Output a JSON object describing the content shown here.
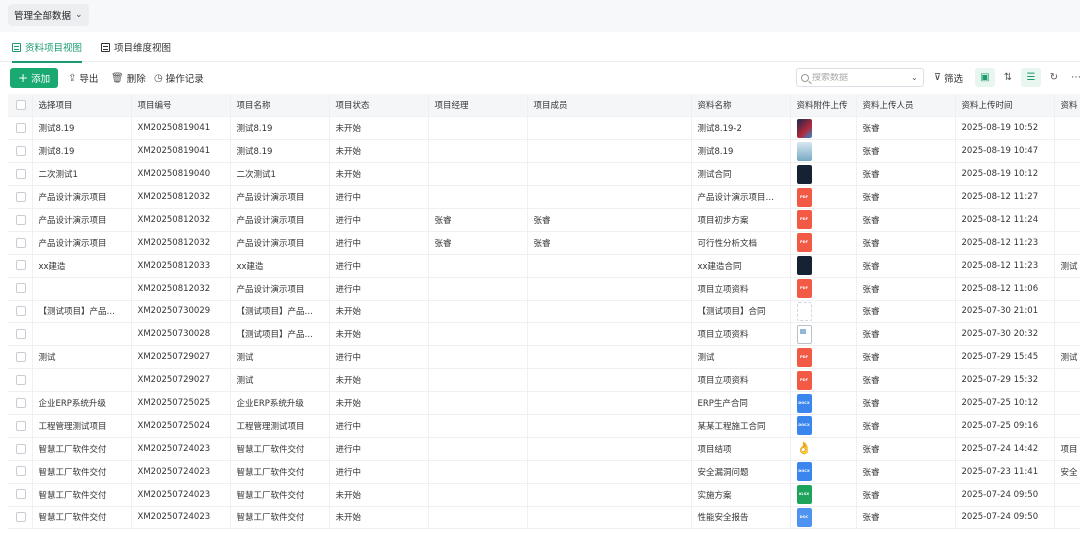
{
  "scope_select": {
    "label": "管理全部数据"
  },
  "view_tabs": [
    {
      "label": "资料项目视图",
      "active": true
    },
    {
      "label": "项目维度视图",
      "active": false
    }
  ],
  "toolbar": {
    "add_label": "添加",
    "export_label": "导出",
    "delete_label": "删除",
    "log_label": "操作记录",
    "search_placeholder": "搜索数据",
    "filter_label": "筛选"
  },
  "colors": {
    "accent": "#1aa971"
  },
  "columns": [
    "选择项目",
    "项目编号",
    "项目名称",
    "项目状态",
    "项目经理",
    "项目成员",
    "资料名称",
    "资料附件上传",
    "资料上传人员",
    "资料上传时间",
    "资料"
  ],
  "rows": [
    {
      "select": "测试8.19",
      "code": "XM20250819041",
      "name": "测试8.19",
      "status": "未开始",
      "manager": "",
      "members": "",
      "doc": "测试8.19-2",
      "file": "img1",
      "uploader": "张睿",
      "time": "2025-08-19 10:52",
      "extra": ""
    },
    {
      "select": "测试8.19",
      "code": "XM20250819041",
      "name": "测试8.19",
      "status": "未开始",
      "manager": "",
      "members": "",
      "doc": "测试8.19",
      "file": "img2",
      "uploader": "张睿",
      "time": "2025-08-19 10:47",
      "extra": ""
    },
    {
      "select": "二次测试1",
      "code": "XM20250819040",
      "name": "二次测试1",
      "status": "未开始",
      "manager": "",
      "members": "",
      "doc": "测试合同",
      "file": "dark",
      "uploader": "张睿",
      "time": "2025-08-19 10:12",
      "extra": ""
    },
    {
      "select": "产品设计演示项目",
      "code": "XM20250812032",
      "name": "产品设计演示项目",
      "status": "进行中",
      "manager": "",
      "members": "",
      "doc": "产品设计演示项目…",
      "file": "pdf",
      "uploader": "张睿",
      "time": "2025-08-12 11:27",
      "extra": ""
    },
    {
      "select": "产品设计演示项目",
      "code": "XM20250812032",
      "name": "产品设计演示项目",
      "status": "进行中",
      "manager": "张睿",
      "members": "张睿",
      "doc": "项目初步方案",
      "file": "pdf",
      "uploader": "张睿",
      "time": "2025-08-12 11:24",
      "extra": ""
    },
    {
      "select": "产品设计演示项目",
      "code": "XM20250812032",
      "name": "产品设计演示项目",
      "status": "进行中",
      "manager": "张睿",
      "members": "张睿",
      "doc": "可行性分析文档",
      "file": "pdf",
      "uploader": "张睿",
      "time": "2025-08-12 11:23",
      "extra": ""
    },
    {
      "select": "xx建造",
      "code": "XM20250812033",
      "name": "xx建造",
      "status": "进行中",
      "manager": "",
      "members": "",
      "doc": "xx建造合同",
      "file": "dark",
      "uploader": "张睿",
      "time": "2025-08-12 11:23",
      "extra": "测试"
    },
    {
      "select": "",
      "code": "XM20250812032",
      "name": "产品设计演示项目",
      "status": "进行中",
      "manager": "",
      "members": "",
      "doc": "项目立项资料",
      "file": "pdf",
      "uploader": "张睿",
      "time": "2025-08-12 11:06",
      "extra": ""
    },
    {
      "select": "【测试项目】产品…",
      "code": "XM20250730029",
      "name": "【测试项目】产品…",
      "status": "未开始",
      "manager": "",
      "members": "",
      "doc": "【测试项目】合同",
      "file": "blank",
      "uploader": "张睿",
      "time": "2025-07-30 21:01",
      "extra": ""
    },
    {
      "select": "",
      "code": "XM20250730028",
      "name": "【测试项目】产品…",
      "status": "未开始",
      "manager": "",
      "members": "",
      "doc": "项目立项资料",
      "file": "broken",
      "uploader": "张睿",
      "time": "2025-07-30 20:32",
      "extra": ""
    },
    {
      "select": "测试",
      "code": "XM20250729027",
      "name": "测试",
      "status": "进行中",
      "manager": "",
      "members": "",
      "doc": "测试",
      "file": "pdf",
      "uploader": "张睿",
      "time": "2025-07-29 15:45",
      "extra": "测试"
    },
    {
      "select": "",
      "code": "XM20250729027",
      "name": "测试",
      "status": "未开始",
      "manager": "",
      "members": "",
      "doc": "项目立项资料",
      "file": "pdf",
      "uploader": "张睿",
      "time": "2025-07-29 15:32",
      "extra": ""
    },
    {
      "select": "企业ERP系统升级",
      "code": "XM20250725025",
      "name": "企业ERP系统升级",
      "status": "未开始",
      "manager": "",
      "members": "",
      "doc": "ERP生产合同",
      "file": "docx",
      "uploader": "张睿",
      "time": "2025-07-25 10:12",
      "extra": ""
    },
    {
      "select": "工程管理测试项目",
      "code": "XM20250725024",
      "name": "工程管理测试项目",
      "status": "进行中",
      "manager": "",
      "members": "",
      "doc": "某某工程施工合同",
      "file": "docx",
      "uploader": "张睿",
      "time": "2025-07-25 09:16",
      "extra": ""
    },
    {
      "select": "智慧工厂软件交付",
      "code": "XM20250724023",
      "name": "智慧工厂软件交付",
      "status": "进行中",
      "manager": "",
      "members": "",
      "doc": "项目结项",
      "file": "hand",
      "uploader": "张睿",
      "time": "2025-07-24 14:42",
      "extra": "项目"
    },
    {
      "select": "智慧工厂软件交付",
      "code": "XM20250724023",
      "name": "智慧工厂软件交付",
      "status": "进行中",
      "manager": "",
      "members": "",
      "doc": "安全漏洞问题",
      "file": "docx",
      "uploader": "张睿",
      "time": "2025-07-23 11:41",
      "extra": "安全"
    },
    {
      "select": "智慧工厂软件交付",
      "code": "XM20250724023",
      "name": "智慧工厂软件交付",
      "status": "未开始",
      "manager": "",
      "members": "",
      "doc": "实施方案",
      "file": "xlsx",
      "uploader": "张睿",
      "time": "2025-07-24 09:50",
      "extra": ""
    },
    {
      "select": "智慧工厂软件交付",
      "code": "XM20250724023",
      "name": "智慧工厂软件交付",
      "status": "未开始",
      "manager": "",
      "members": "",
      "doc": "性能安全报告",
      "file": "doc",
      "uploader": "张睿",
      "time": "2025-07-24 09:50",
      "extra": ""
    }
  ],
  "file_icon_labels": {
    "pdf": "PDF",
    "docx": "DOCX",
    "doc": "DOC",
    "xlsx": "XLSX"
  }
}
